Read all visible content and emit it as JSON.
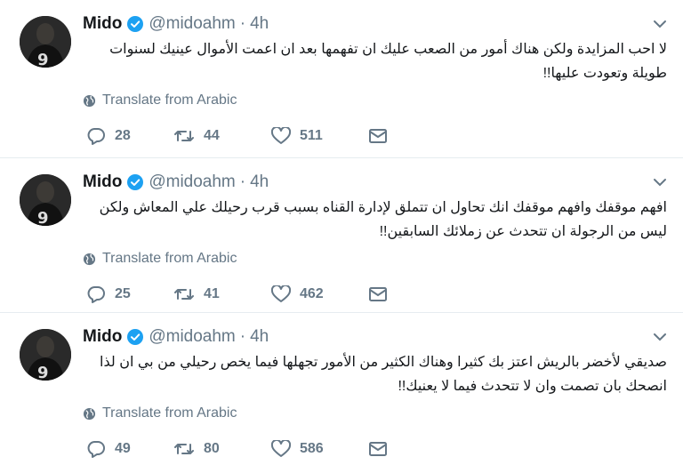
{
  "tweets": [
    {
      "name": "Mido",
      "handle": "@midoahm",
      "separator": "·",
      "time": "4h",
      "text": "لا احب المزايدة ولكن هناك أمور من الصعب عليك ان تفهمها بعد ان اعمت الأموال عينيك لسنوات طويلة وتعودت عليها!!",
      "translate_label": "Translate from Arabic",
      "replies": "28",
      "retweets": "44",
      "likes": "511"
    },
    {
      "name": "Mido",
      "handle": "@midoahm",
      "separator": "·",
      "time": "4h",
      "text": "افهم موقفك وافهم موقفك انك تحاول ان تتملق لإدارة القناه بسبب قرب رحيلك علي المعاش ولكن ليس من الرجولة ان تتحدث عن زملائك السابقين!!",
      "translate_label": "Translate from Arabic",
      "replies": "25",
      "retweets": "41",
      "likes": "462"
    },
    {
      "name": "Mido",
      "handle": "@midoahm",
      "separator": "·",
      "time": "4h",
      "text": "صديقي لأخضر بالريش اعتز بك كثيرا وهناك الكثير من الأمور تجهلها فيما يخص رحيلي من بي ان لذا انصحك بان تصمت وان لا تتحدث فيما لا يعنيك!!",
      "translate_label": "Translate from Arabic",
      "replies": "49",
      "retweets": "80",
      "likes": "586"
    }
  ],
  "icons": {
    "verified": "verified-badge-icon",
    "caret": "chevron-down-icon",
    "globe": "globe-icon",
    "reply": "reply-icon",
    "retweet": "retweet-icon",
    "like": "heart-icon",
    "dm": "envelope-icon"
  },
  "colors": {
    "text": "#14171a",
    "muted": "#657786",
    "verified": "#1da1f2",
    "divider": "#e6ecf0"
  }
}
